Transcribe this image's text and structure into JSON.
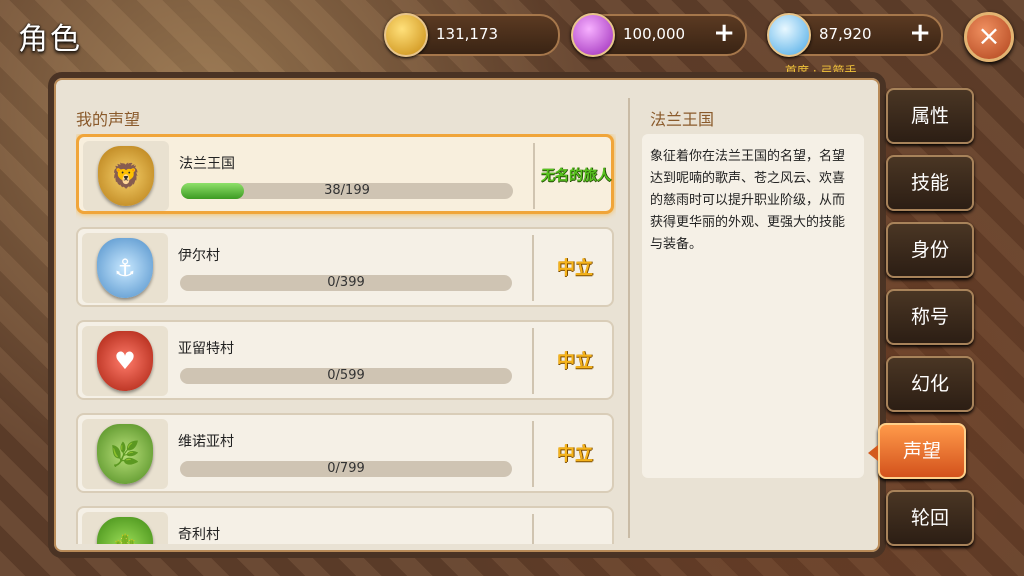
{
  "header": {
    "title": "角色",
    "subtle_text": "首席 · 弓箭手"
  },
  "currencies": [
    {
      "icon": "gold-coin-icon",
      "value": "131,173",
      "has_plus": false
    },
    {
      "icon": "purple-gem-icon",
      "value": "100,000",
      "has_plus": true
    },
    {
      "icon": "diamond-icon",
      "value": "87,920",
      "has_plus": true
    }
  ],
  "close": {
    "symbol": "×"
  },
  "panel": {
    "left_title": "我的声望",
    "right_title": "法兰王国",
    "description": "象征着你在法兰王国的名望，名望达到呢喃的歌声、苍之风云、欢喜的慈雨时可以提升职业阶级，从而获得更华丽的外观、更强大的技能与装备。"
  },
  "reputations": [
    {
      "name": "法兰王国",
      "progress_text": "38/199",
      "progress": 0.19,
      "status": "无名的旅人",
      "emblem": "lion-shield-icon",
      "selected": true
    },
    {
      "name": "伊尔村",
      "progress_text": "0/399",
      "progress": 0,
      "status": "中立",
      "emblem": "winged-anchor-icon",
      "selected": false
    },
    {
      "name": "亚留特村",
      "progress_text": "0/599",
      "progress": 0,
      "status": "中立",
      "emblem": "red-heart-shield-icon",
      "selected": false
    },
    {
      "name": "维诺亚村",
      "progress_text": "0/799",
      "progress": 0,
      "status": "中立",
      "emblem": "green-serpent-tree-icon",
      "selected": false
    },
    {
      "name": "奇利村",
      "progress_text": "",
      "progress": 0,
      "status": "",
      "emblem": "green-cactus-icon",
      "selected": false
    }
  ],
  "tabs": [
    {
      "label": "属性",
      "active": false
    },
    {
      "label": "技能",
      "active": false
    },
    {
      "label": "身份",
      "active": false
    },
    {
      "label": "称号",
      "active": false
    },
    {
      "label": "幻化",
      "active": false
    },
    {
      "label": "声望",
      "active": true
    },
    {
      "label": "轮回",
      "active": false
    }
  ],
  "colors": {
    "accent": "#f0a53a",
    "status_neutral": "#f5b31b",
    "status_traveler": "#58c21f",
    "progress": "#3c9b23"
  }
}
